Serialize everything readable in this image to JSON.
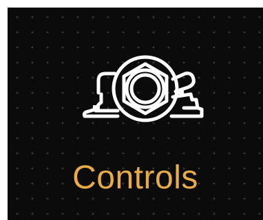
{
  "tile": {
    "label": "Controls",
    "icon": "controls-icon",
    "background_color": "#0b0b0b",
    "accent_color": "#e8ac47",
    "icon_color": "#ffffff"
  }
}
